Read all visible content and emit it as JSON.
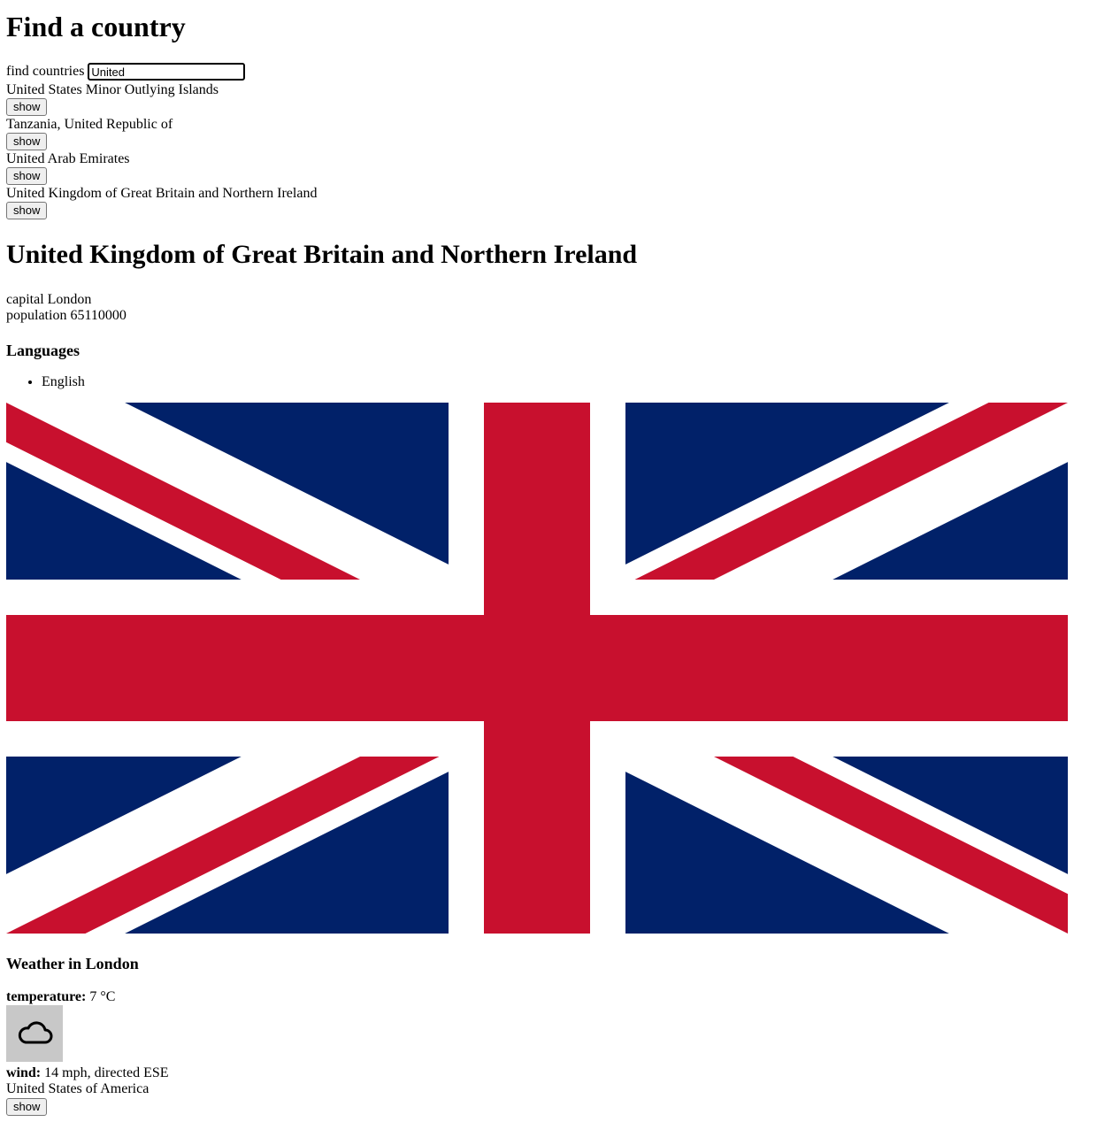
{
  "page": {
    "title": "Find a country"
  },
  "search": {
    "label": "find countries",
    "value": "United"
  },
  "results": [
    {
      "name": "United States Minor Outlying Islands",
      "button_label": "show"
    },
    {
      "name": "Tanzania, United Republic of",
      "button_label": "show"
    },
    {
      "name": "United Arab Emirates",
      "button_label": "show"
    },
    {
      "name": "United Kingdom of Great Britain and Northern Ireland",
      "button_label": "show"
    }
  ],
  "country": {
    "name": "United Kingdom of Great Britain and Northern Ireland",
    "capital_label": "capital",
    "capital": "London",
    "population_label": "population",
    "population": "65110000",
    "languages_title": "Languages",
    "languages": [
      "English"
    ],
    "flag_icon": "united-kingdom-flag",
    "flag_colors": {
      "blue": "#012169",
      "red": "#C8102E",
      "white": "#FFFFFF"
    }
  },
  "weather": {
    "title": "Weather in London",
    "temperature_label": "temperature:",
    "temperature": "7 °C",
    "icon": "cloud-icon",
    "wind_label": "wind:",
    "wind": "14 mph, directed ESE"
  },
  "extra_result": {
    "name": "United States of America",
    "button_label": "show"
  }
}
